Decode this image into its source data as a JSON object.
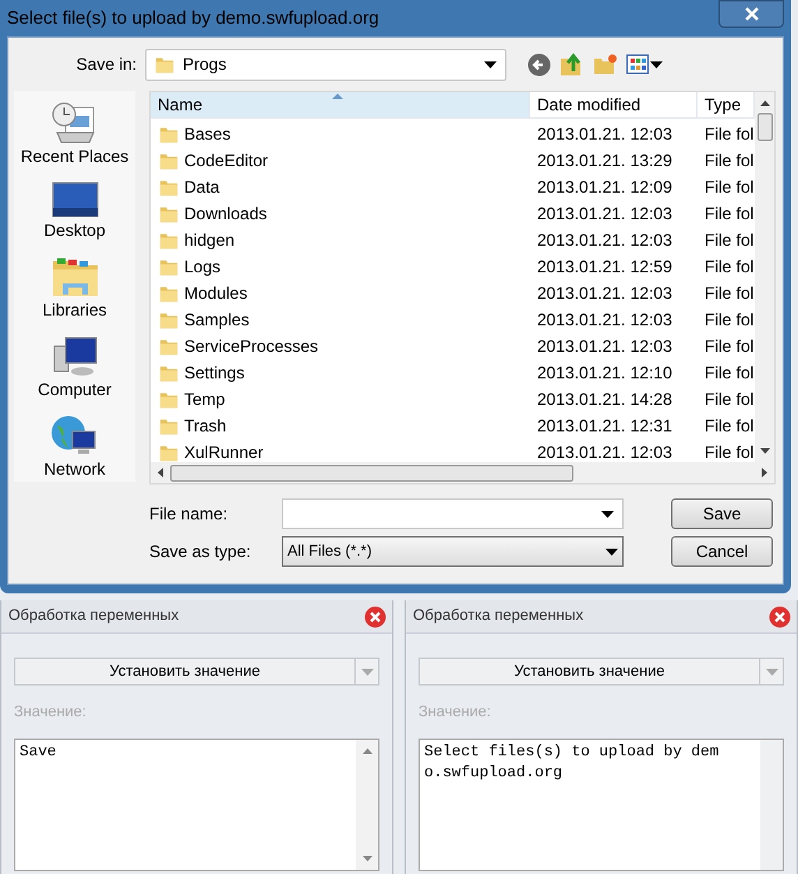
{
  "window": {
    "title": "Select file(s) to upload by demo.swfupload.org"
  },
  "save_in": {
    "label": "Save in:",
    "value": "Progs"
  },
  "sidebar": {
    "items": [
      {
        "label": "Recent Places",
        "kind": "recent"
      },
      {
        "label": "Desktop",
        "kind": "desktop"
      },
      {
        "label": "Libraries",
        "kind": "libraries"
      },
      {
        "label": "Computer",
        "kind": "computer"
      },
      {
        "label": "Network",
        "kind": "network"
      }
    ]
  },
  "table": {
    "columns": [
      {
        "label": "Name",
        "sorted": true
      },
      {
        "label": "Date modified",
        "sorted": false
      },
      {
        "label": "Type",
        "sorted": false
      }
    ],
    "rows": [
      {
        "name": "Bases",
        "date": "2013.01.21. 12:03",
        "type": "File fol"
      },
      {
        "name": "CodeEditor",
        "date": "2013.01.21. 13:29",
        "type": "File fol"
      },
      {
        "name": "Data",
        "date": "2013.01.21. 12:09",
        "type": "File fol"
      },
      {
        "name": "Downloads",
        "date": "2013.01.21. 12:03",
        "type": "File fol"
      },
      {
        "name": "hidgen",
        "date": "2013.01.21. 12:03",
        "type": "File fol"
      },
      {
        "name": "Logs",
        "date": "2013.01.21. 12:59",
        "type": "File fol"
      },
      {
        "name": "Modules",
        "date": "2013.01.21. 12:03",
        "type": "File fol"
      },
      {
        "name": "Samples",
        "date": "2013.01.21. 12:03",
        "type": "File fol"
      },
      {
        "name": "ServiceProcesses",
        "date": "2013.01.21. 12:03",
        "type": "File fol"
      },
      {
        "name": "Settings",
        "date": "2013.01.21. 12:10",
        "type": "File fol"
      },
      {
        "name": "Temp",
        "date": "2013.01.21. 14:28",
        "type": "File fol"
      },
      {
        "name": "Trash",
        "date": "2013.01.21. 12:31",
        "type": "File fol"
      },
      {
        "name": "XulRunner",
        "date": "2013.01.21. 12:03",
        "type": "File fol"
      }
    ]
  },
  "file_name": {
    "label": "File name:"
  },
  "save_as_type": {
    "label": "Save as type:",
    "value": "All Files (*.*)"
  },
  "buttons": [
    "Save",
    "Cancel"
  ],
  "panels": [
    {
      "title": "Обработка переменных",
      "action": "Установить значение",
      "value_label": "Значение:",
      "value": "Save",
      "scrollbar": true
    },
    {
      "title": "Обработка переменных",
      "action": "Установить значение",
      "value_label": "Значение:",
      "value": "Select files(s) to upload by demo.swfupload.org",
      "scrollbar": false
    }
  ]
}
